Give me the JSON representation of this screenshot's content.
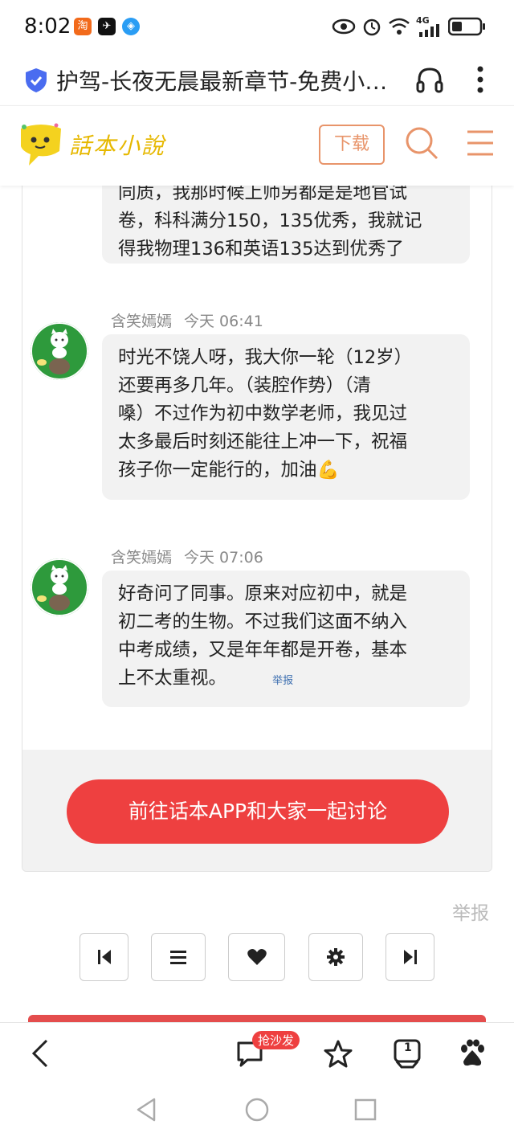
{
  "status_bar": {
    "time": "8:02",
    "apps": [
      "淘",
      "✈",
      "◈"
    ],
    "network": "4G"
  },
  "browser": {
    "title": "护驾-长夜无晨最新章节-免费小…"
  },
  "site": {
    "logo": "話本小說",
    "download_label": "下载"
  },
  "comments": [
    {
      "author": "",
      "time": "",
      "lines": [
        "同质，我那时候上师另都是是地官试",
        "卷，科科满分150，135优秀，我就记",
        "得我物理136和英语135达到优秀了"
      ]
    },
    {
      "author": "含笑嫣嫣",
      "time": "今天 06:41",
      "lines": [
        "时光不饶人呀，我大你一轮（12岁）",
        "还要再多几年。（装腔作势）（清",
        "嗓）不过作为初中数学老师，我见过",
        "太多最后时刻还能往上冲一下，祝福",
        "孩子你一定能行的，加油💪"
      ]
    },
    {
      "author": "含笑嫣嫣",
      "time": "今天 07:06",
      "lines": [
        "好奇问了同事。原来对应初中，就是",
        "初二考的生物。不过我们这面不纳入",
        "中考成绩，又是年年都是开卷，基本",
        "上不太重视。"
      ],
      "report": "举报"
    }
  ],
  "cta_label": "前往话本APP和大家一起讨论",
  "report_label": "举报",
  "bottom_bar": {
    "badge": "抢沙发",
    "bookmark_count": "1"
  },
  "colors": {
    "accent_red": "#ee4040",
    "download_orange": "#e8946a",
    "avatar_green": "#2e9a3c"
  }
}
